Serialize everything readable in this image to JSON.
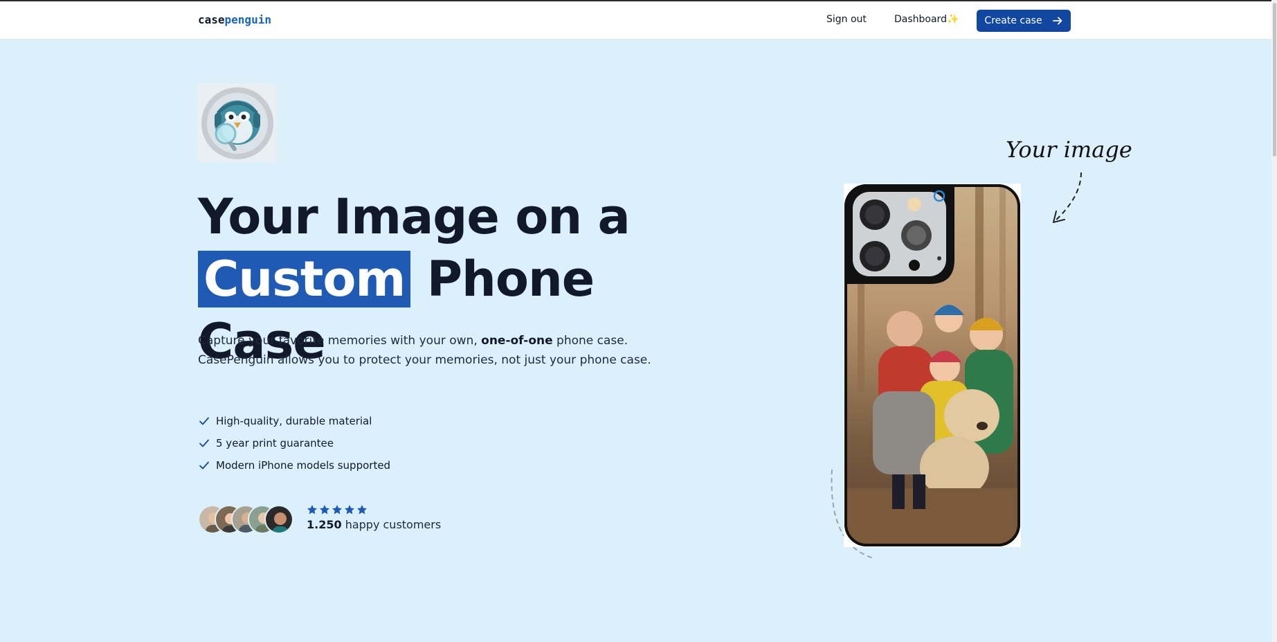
{
  "nav": {
    "logo_part1": "case",
    "logo_part2": "penguin",
    "signout": "Sign out",
    "dashboard": "Dashboard✨",
    "create": "Create case"
  },
  "hero": {
    "title_line1": "Your Image on a",
    "title_highlight": "Custom",
    "title_rest": " Phone Case",
    "sub_part1": "Capture your favorite memories with your own, ",
    "sub_bold": "one-of-one",
    "sub_part2": " phone case. CasePenguin allows you to protect your memories, not just your phone case.",
    "features": [
      "High-quality, durable material",
      "5 year print guarantee",
      "Modern iPhone models supported"
    ],
    "rating_stars": 5,
    "customers_count": "1.250",
    "customers_label": " happy customers"
  },
  "phone": {
    "annotation": "Your image"
  },
  "colors": {
    "accent": "#1147a0",
    "highlight": "#1f5bb5",
    "background": "#dcf0fb",
    "star": "#1f5bb5"
  }
}
